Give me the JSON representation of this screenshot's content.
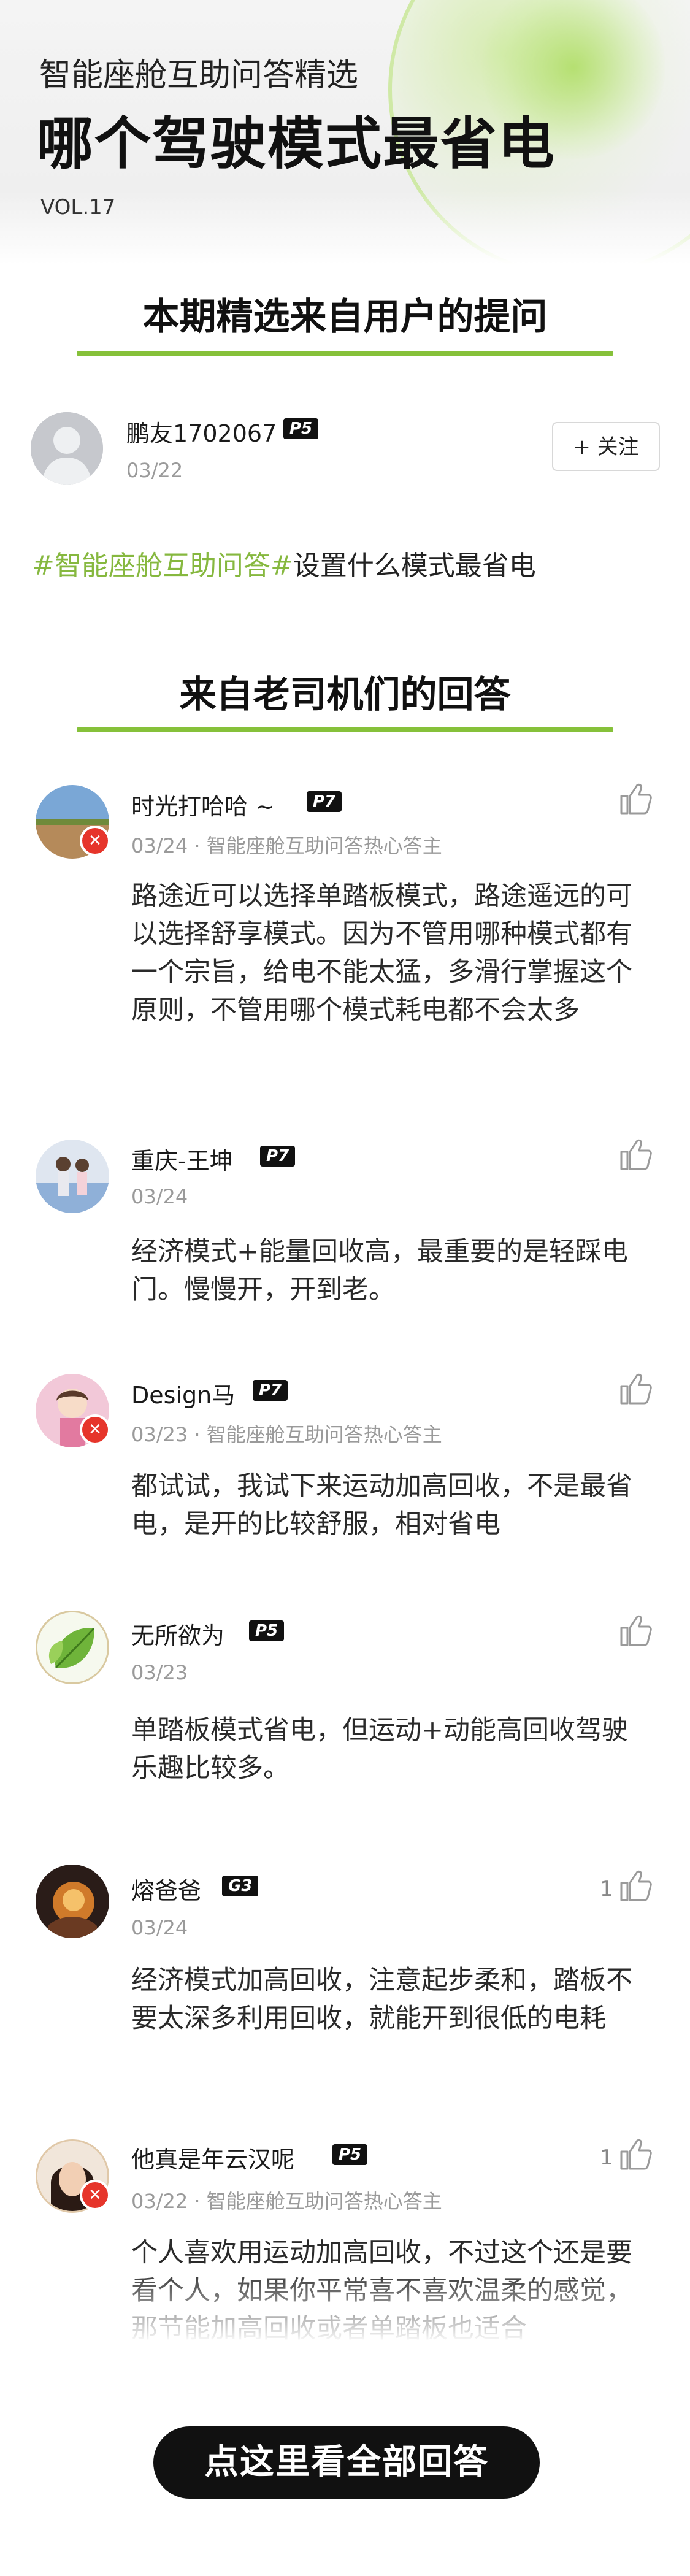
{
  "header": {
    "subtitle": "智能座舱互助问答精选",
    "title": "哪个驾驶模式最省电",
    "vol": "VOL.17"
  },
  "question_section": {
    "title": "本期精选来自用户的提问",
    "asker": {
      "name": "鹏友1702067",
      "level": "P5",
      "date": "03/22"
    },
    "follow_label": "+ 关注",
    "topic_tag": "#智能座舱互助问答#",
    "topic_text": "设置什么模式最省电"
  },
  "answer_section": {
    "title": "来自老司机们的回答",
    "answers": [
      {
        "name": "时光打哈哈 ~",
        "level": "P7",
        "date": "03/24",
        "role": "· 智能座舱互助问答热心答主",
        "likes": "",
        "text": "路途近可以选择单踏板模式，路途遥远的可以选择舒享模式。因为不管用哪种模式都有一个宗旨，给电不能太猛，多滑行掌握这个原则，不管用哪个模式耗电都不会太多"
      },
      {
        "name": "重庆-王坤",
        "level": "P7",
        "date": "03/24",
        "role": "",
        "likes": "",
        "text": "经济模式+能量回收高，最重要的是轻踩电门。慢慢开，开到老。"
      },
      {
        "name": "Design马",
        "level": "P7",
        "date": "03/23",
        "role": "· 智能座舱互助问答热心答主",
        "likes": "",
        "text": "都试试，我试下来运动加高回收，不是最省电，是开的比较舒服，相对省电"
      },
      {
        "name": "无所欲为",
        "level": "P5",
        "date": "03/23",
        "role": "",
        "likes": "",
        "text": "单踏板模式省电，但运动+动能高回收驾驶乐趣比较多。"
      },
      {
        "name": "熔爸爸",
        "level": "G3",
        "date": "03/24",
        "role": "",
        "likes": "1",
        "text": "经济模式加高回收，注意起步柔和，踏板不要太深多利用回收，就能开到很低的电耗"
      },
      {
        "name": "他真是年云汉呢",
        "level": "P5",
        "date": "03/22",
        "role": "· 智能座舱互助问答热心答主",
        "likes": "1",
        "text": "个人喜欢用运动加高回收，不过这个还是要看个人，如果你平常喜不喜欢温柔的感觉，那节能加高回收或者单踏板也适合"
      }
    ]
  },
  "cta_label": "点这里看全部回答",
  "colors": {
    "accent": "#86c13a",
    "badge_red": "#e6352b",
    "badge_dark": "#111111"
  }
}
